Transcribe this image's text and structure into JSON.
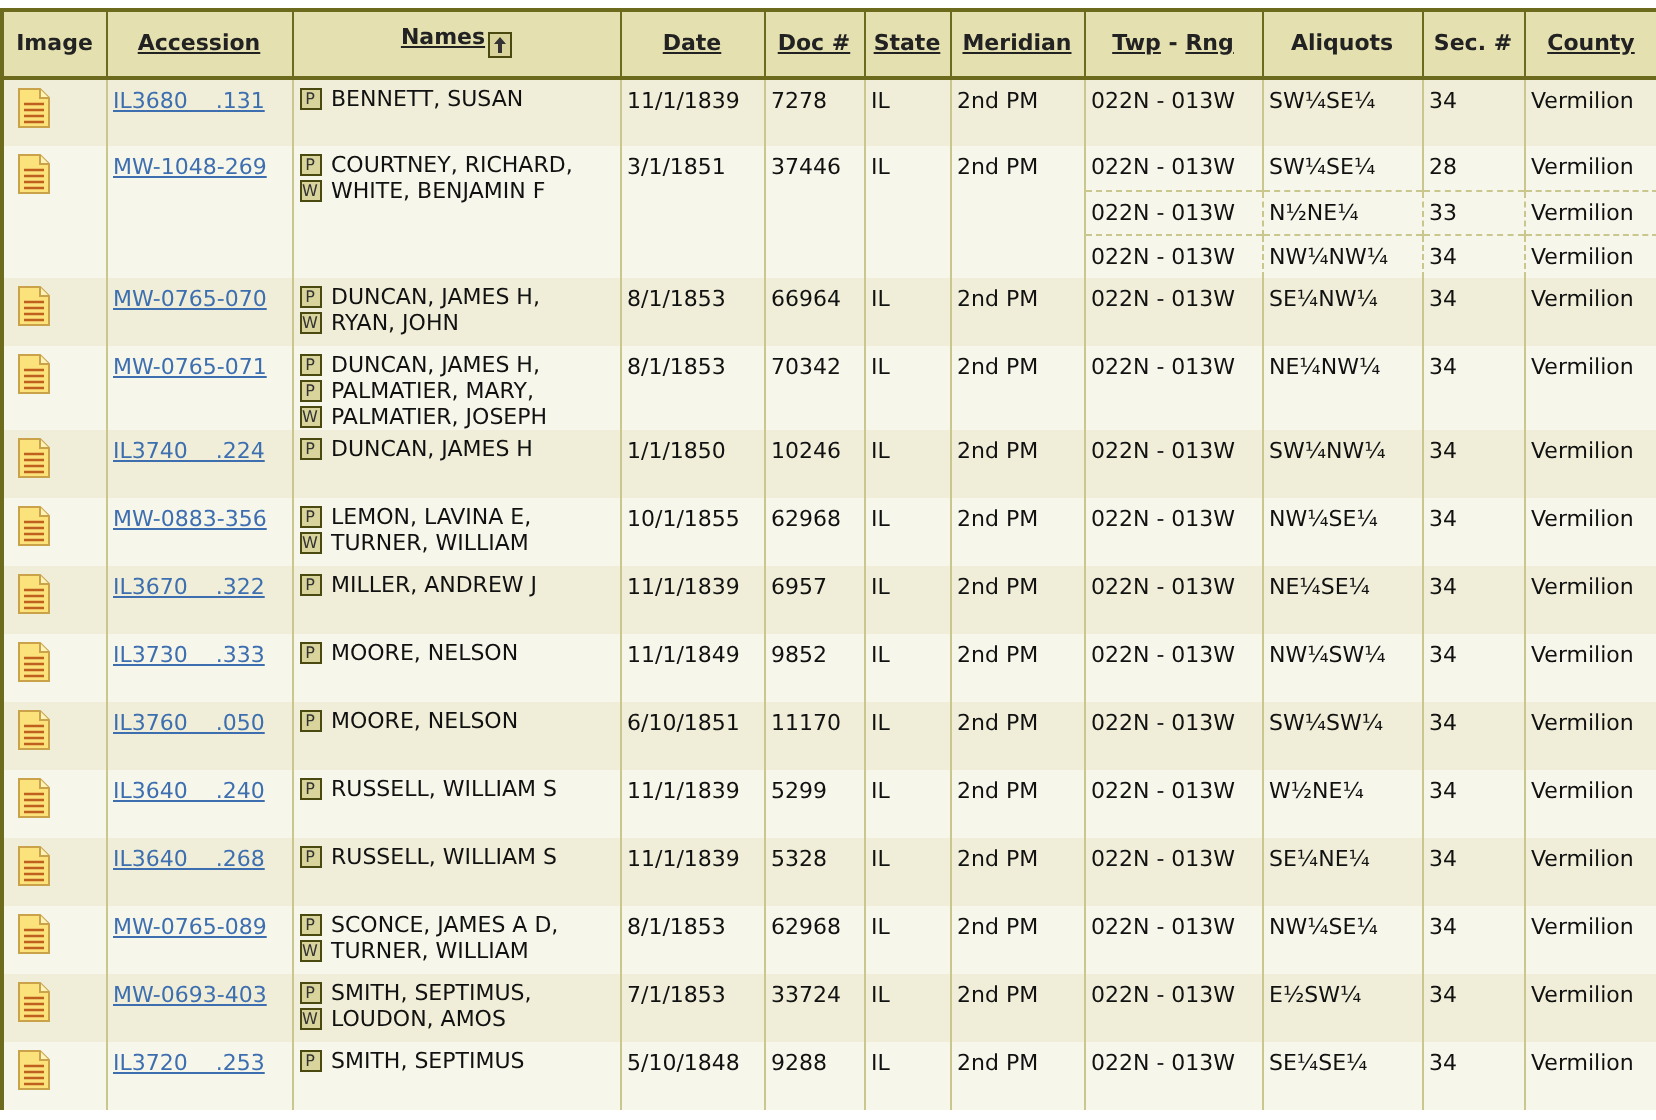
{
  "table": {
    "columns": [
      {
        "label": "Image",
        "kind": "plain",
        "sorted": false
      },
      {
        "label": "Accession",
        "kind": "link",
        "sorted": false
      },
      {
        "label": "Names",
        "kind": "link",
        "sorted": true
      },
      {
        "label": "Date",
        "kind": "link",
        "sorted": false
      },
      {
        "label": "Doc #",
        "kind": "link",
        "sorted": false
      },
      {
        "label": "State",
        "kind": "link",
        "sorted": false
      },
      {
        "label": "Meridian",
        "kind": "link",
        "sorted": false
      },
      {
        "kind": "pair",
        "parts": [
          "Twp",
          "Rng"
        ],
        "separator": "-",
        "sorted": false
      },
      {
        "label": "Aliquots",
        "kind": "plain",
        "sorted": false
      },
      {
        "label": "Sec. #",
        "kind": "plain",
        "sorted": false
      },
      {
        "label": "County",
        "kind": "link",
        "sorted": false
      }
    ],
    "rows": [
      {
        "accession": "IL3680    .131",
        "names": [
          {
            "role": "P",
            "name": "BENNETT, SUSAN"
          }
        ],
        "date": "11/1/1839",
        "doc": "7278",
        "state": "IL",
        "meridian": "2nd PM",
        "lands": [
          {
            "twp_rng": "022N - 013W",
            "aliquots": "SW¼SE¼",
            "sec": "34",
            "county": "Vermilion"
          }
        ]
      },
      {
        "accession": "MW-1048-269",
        "names": [
          {
            "role": "P",
            "name": "COURTNEY, RICHARD,"
          },
          {
            "role": "W",
            "name": "WHITE, BENJAMIN F"
          }
        ],
        "date": "3/1/1851",
        "doc": "37446",
        "state": "IL",
        "meridian": "2nd PM",
        "lands": [
          {
            "twp_rng": "022N - 013W",
            "aliquots": "SW¼SE¼",
            "sec": "28",
            "county": "Vermilion"
          },
          {
            "twp_rng": "022N - 013W",
            "aliquots": "N½NE¼",
            "sec": "33",
            "county": "Vermilion"
          },
          {
            "twp_rng": "022N - 013W",
            "aliquots": "NW¼NW¼",
            "sec": "34",
            "county": "Vermilion"
          }
        ]
      },
      {
        "accession": "MW-0765-070",
        "names": [
          {
            "role": "P",
            "name": "DUNCAN, JAMES H,"
          },
          {
            "role": "W",
            "name": "RYAN, JOHN"
          }
        ],
        "date": "8/1/1853",
        "doc": "66964",
        "state": "IL",
        "meridian": "2nd PM",
        "lands": [
          {
            "twp_rng": "022N - 013W",
            "aliquots": "SE¼NW¼",
            "sec": "34",
            "county": "Vermilion"
          }
        ]
      },
      {
        "accession": "MW-0765-071",
        "names": [
          {
            "role": "P",
            "name": "DUNCAN, JAMES H,"
          },
          {
            "role": "P",
            "name": "PALMATIER, MARY,"
          },
          {
            "role": "W",
            "name": "PALMATIER, JOSEPH"
          }
        ],
        "date": "8/1/1853",
        "doc": "70342",
        "state": "IL",
        "meridian": "2nd PM",
        "lands": [
          {
            "twp_rng": "022N - 013W",
            "aliquots": "NE¼NW¼",
            "sec": "34",
            "county": "Vermilion"
          }
        ]
      },
      {
        "accession": "IL3740    .224",
        "names": [
          {
            "role": "P",
            "name": "DUNCAN, JAMES H"
          }
        ],
        "date": "1/1/1850",
        "doc": "10246",
        "state": "IL",
        "meridian": "2nd PM",
        "lands": [
          {
            "twp_rng": "022N - 013W",
            "aliquots": "SW¼NW¼",
            "sec": "34",
            "county": "Vermilion"
          }
        ]
      },
      {
        "accession": "MW-0883-356",
        "names": [
          {
            "role": "P",
            "name": "LEMON, LAVINA E,"
          },
          {
            "role": "W",
            "name": "TURNER, WILLIAM"
          }
        ],
        "date": "10/1/1855",
        "doc": "62968",
        "state": "IL",
        "meridian": "2nd PM",
        "lands": [
          {
            "twp_rng": "022N - 013W",
            "aliquots": "NW¼SE¼",
            "sec": "34",
            "county": "Vermilion"
          }
        ]
      },
      {
        "accession": "IL3670    .322",
        "names": [
          {
            "role": "P",
            "name": "MILLER, ANDREW J"
          }
        ],
        "date": "11/1/1839",
        "doc": "6957",
        "state": "IL",
        "meridian": "2nd PM",
        "lands": [
          {
            "twp_rng": "022N - 013W",
            "aliquots": "NE¼SE¼",
            "sec": "34",
            "county": "Vermilion"
          }
        ]
      },
      {
        "accession": "IL3730    .333",
        "names": [
          {
            "role": "P",
            "name": "MOORE, NELSON"
          }
        ],
        "date": "11/1/1849",
        "doc": "9852",
        "state": "IL",
        "meridian": "2nd PM",
        "lands": [
          {
            "twp_rng": "022N - 013W",
            "aliquots": "NW¼SW¼",
            "sec": "34",
            "county": "Vermilion"
          }
        ]
      },
      {
        "accession": "IL3760    .050",
        "names": [
          {
            "role": "P",
            "name": "MOORE, NELSON"
          }
        ],
        "date": "6/10/1851",
        "doc": "11170",
        "state": "IL",
        "meridian": "2nd PM",
        "lands": [
          {
            "twp_rng": "022N - 013W",
            "aliquots": "SW¼SW¼",
            "sec": "34",
            "county": "Vermilion"
          }
        ]
      },
      {
        "accession": "IL3640    .240",
        "names": [
          {
            "role": "P",
            "name": "RUSSELL, WILLIAM S"
          }
        ],
        "date": "11/1/1839",
        "doc": "5299",
        "state": "IL",
        "meridian": "2nd PM",
        "lands": [
          {
            "twp_rng": "022N - 013W",
            "aliquots": "W½NE¼",
            "sec": "34",
            "county": "Vermilion"
          }
        ]
      },
      {
        "accession": "IL3640    .268",
        "names": [
          {
            "role": "P",
            "name": "RUSSELL, WILLIAM S"
          }
        ],
        "date": "11/1/1839",
        "doc": "5328",
        "state": "IL",
        "meridian": "2nd PM",
        "lands": [
          {
            "twp_rng": "022N - 013W",
            "aliquots": "SE¼NE¼",
            "sec": "34",
            "county": "Vermilion"
          }
        ]
      },
      {
        "accession": "MW-0765-089",
        "names": [
          {
            "role": "P",
            "name": "SCONCE, JAMES A D,"
          },
          {
            "role": "W",
            "name": "TURNER, WILLIAM"
          }
        ],
        "date": "8/1/1853",
        "doc": "62968",
        "state": "IL",
        "meridian": "2nd PM",
        "lands": [
          {
            "twp_rng": "022N - 013W",
            "aliquots": "NW¼SE¼",
            "sec": "34",
            "county": "Vermilion"
          }
        ]
      },
      {
        "accession": "MW-0693-403",
        "names": [
          {
            "role": "P",
            "name": "SMITH, SEPTIMUS,"
          },
          {
            "role": "W",
            "name": "LOUDON, AMOS"
          }
        ],
        "date": "7/1/1853",
        "doc": "33724",
        "state": "IL",
        "meridian": "2nd PM",
        "lands": [
          {
            "twp_rng": "022N - 013W",
            "aliquots": "E½SW¼",
            "sec": "34",
            "county": "Vermilion"
          }
        ]
      },
      {
        "accession": "IL3720    .253",
        "names": [
          {
            "role": "P",
            "name": "SMITH, SEPTIMUS"
          }
        ],
        "date": "5/10/1848",
        "doc": "9288",
        "state": "IL",
        "meridian": "2nd PM",
        "lands": [
          {
            "twp_rng": "022N - 013W",
            "aliquots": "SE¼SE¼",
            "sec": "34",
            "county": "Vermilion"
          }
        ]
      }
    ]
  }
}
